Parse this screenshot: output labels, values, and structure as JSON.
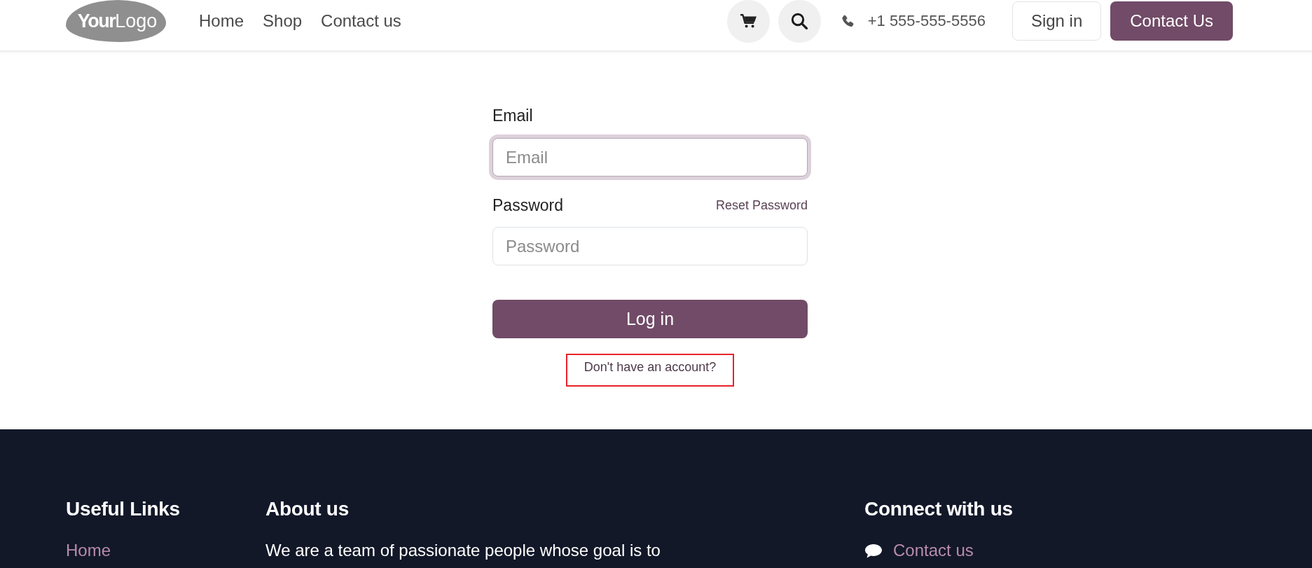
{
  "header": {
    "logo": "**Your**Logo",
    "nav": [
      {
        "label": "Home"
      },
      {
        "label": "Shop"
      },
      {
        "label": "Contact us"
      }
    ],
    "phone": "+1 555-555-5556",
    "sign_in": "Sign in",
    "cta": "Contact Us"
  },
  "login_form": {
    "email": {
      "label": "Email",
      "placeholder": "Email",
      "focused": true
    },
    "password": {
      "label": "Password",
      "placeholder": "Password",
      "focused": false,
      "reset_link": "Reset Password"
    },
    "submit": "Log in",
    "signup_link": {
      "text": "Don't have an account?",
      "highlighted": true
    }
  },
  "footer": {
    "columns": [
      {
        "kind": "links",
        "title": "Useful Links",
        "links": [
          {
            "label": "Home"
          }
        ]
      },
      {
        "kind": "text",
        "title": "About us",
        "text": "We are a team of passionate people whose goal is to"
      },
      {
        "kind": "contact",
        "title": "Connect with us",
        "links": [
          {
            "label": "Contact us"
          }
        ]
      }
    ]
  }
}
